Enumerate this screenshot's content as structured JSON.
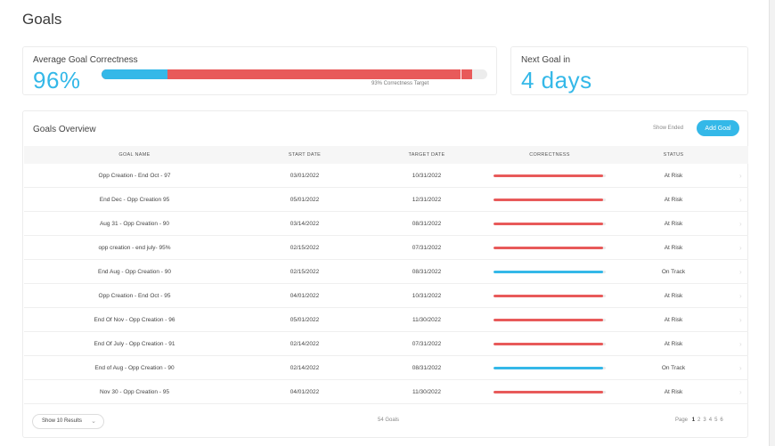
{
  "page": {
    "title": "Goals"
  },
  "avg_card": {
    "label": "Average Goal Correctness",
    "value": "96%",
    "target_label": "93% Correctness Target",
    "progress": {
      "blue_fraction": 0.17,
      "red_fraction": 0.96,
      "target_fraction": 0.93
    }
  },
  "next_card": {
    "label": "Next Goal in",
    "value": "4 days"
  },
  "overview": {
    "title": "Goals Overview",
    "show_ended": "Show Ended",
    "add_goal": "Add Goal",
    "columns": [
      "GOAL NAME",
      "START DATE",
      "TARGET DATE",
      "CORRECTNESS",
      "STATUS"
    ],
    "rows": [
      {
        "name": "Opp Creation - End Oct - 97",
        "start": "03/01/2022",
        "target": "10/31/2022",
        "correctness": 0.98,
        "status": "At Risk",
        "bar_color": "#e85a5a"
      },
      {
        "name": "End Dec - Opp Creation 95",
        "start": "05/01/2022",
        "target": "12/31/2022",
        "correctness": 0.98,
        "status": "At Risk",
        "bar_color": "#e85a5a"
      },
      {
        "name": "Aug 31 - Opp Creation - 90",
        "start": "03/14/2022",
        "target": "08/31/2022",
        "correctness": 0.98,
        "status": "At Risk",
        "bar_color": "#e85a5a"
      },
      {
        "name": "opp creation - end july- 95%",
        "start": "02/15/2022",
        "target": "07/31/2022",
        "correctness": 0.98,
        "status": "At Risk",
        "bar_color": "#e85a5a"
      },
      {
        "name": "End Aug - Opp Creation - 90",
        "start": "02/15/2022",
        "target": "08/31/2022",
        "correctness": 0.98,
        "status": "On Track",
        "bar_color": "#34b8e8"
      },
      {
        "name": "Opp Creation - End Oct - 95",
        "start": "04/01/2022",
        "target": "10/31/2022",
        "correctness": 0.98,
        "status": "At Risk",
        "bar_color": "#e85a5a"
      },
      {
        "name": "End Of Nov - Opp Creation - 96",
        "start": "05/01/2022",
        "target": "11/30/2022",
        "correctness": 0.98,
        "status": "At Risk",
        "bar_color": "#e85a5a"
      },
      {
        "name": "End Of July - Opp Creation - 91",
        "start": "02/14/2022",
        "target": "07/31/2022",
        "correctness": 0.98,
        "status": "At Risk",
        "bar_color": "#e85a5a"
      },
      {
        "name": "End of Aug - Opp Creation - 90",
        "start": "02/14/2022",
        "target": "08/31/2022",
        "correctness": 0.98,
        "status": "On Track",
        "bar_color": "#34b8e8"
      },
      {
        "name": "Nov 30 - Opp Creation - 95",
        "start": "04/01/2022",
        "target": "11/30/2022",
        "correctness": 0.98,
        "status": "At Risk",
        "bar_color": "#e85a5a"
      }
    ]
  },
  "footer": {
    "page_size": "Show 10 Results",
    "total": "54 Goals",
    "page_label": "Page",
    "pages": [
      "1",
      "2",
      "3",
      "4",
      "5",
      "6"
    ],
    "current_page": "1"
  },
  "colors": {
    "accent": "#34b8e8",
    "risk": "#e85a5a"
  },
  "icons": {
    "row_chevron": "chevron-right-icon",
    "dropdown": "chevron-down-icon"
  }
}
